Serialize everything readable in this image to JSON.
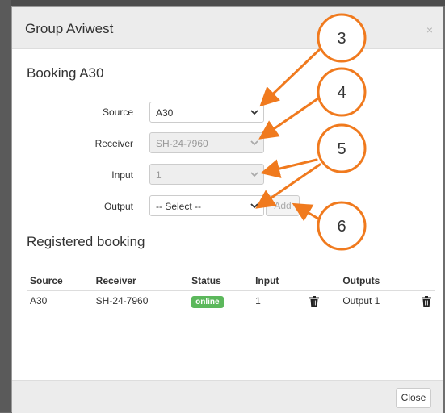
{
  "modal": {
    "title": "Group Aviwest",
    "close_symbol": "×"
  },
  "booking": {
    "title": "Booking A30",
    "source_label": "Source",
    "source_value": "A30",
    "receiver_label": "Receiver",
    "receiver_value": "SH-24-7960",
    "input_label": "Input",
    "input_value": "1",
    "output_label": "Output",
    "output_value": "-- Select --",
    "add_label": "Add"
  },
  "registered": {
    "title": "Registered booking",
    "columns": [
      "Source",
      "Receiver",
      "Status",
      "Input",
      "Outputs"
    ],
    "rows": [
      {
        "source": "A30",
        "receiver": "SH-24-7960",
        "status": "online",
        "input": "1",
        "output": "Output 1"
      }
    ]
  },
  "footer": {
    "close_label": "Close"
  },
  "callouts": [
    "3",
    "4",
    "5",
    "6"
  ],
  "colors": {
    "callout_orange": "#f07a1e",
    "status_online": "#5cb85c",
    "header_bg": "#ececec"
  }
}
